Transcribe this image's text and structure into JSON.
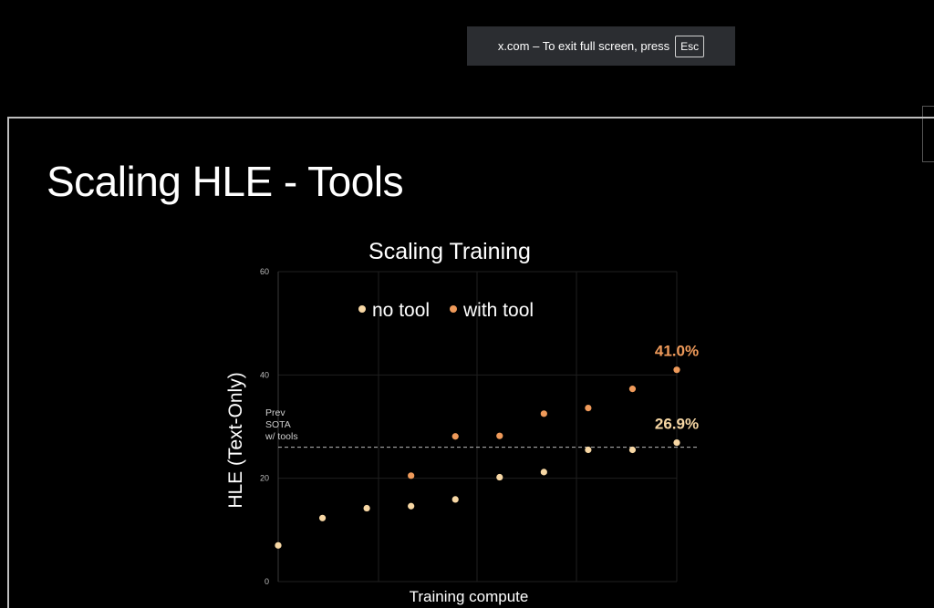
{
  "banner": {
    "message": "x.com – To exit full screen, press",
    "key": "Esc"
  },
  "slide": {
    "title": "Scaling HLE - Tools"
  },
  "chart_data": {
    "type": "scatter",
    "title": "Scaling Training",
    "xlabel": "Training compute",
    "ylabel": "HLE (Text-Only)",
    "ylim": [
      0,
      60
    ],
    "yticks": [
      "0",
      "20",
      "40",
      "60"
    ],
    "grid": true,
    "legend": {
      "placement": "top-left",
      "entries": [
        "no tool",
        "with tool"
      ]
    },
    "series": [
      {
        "name": "no tool",
        "color": "#f7d7a4",
        "x": [
          1,
          2,
          3,
          4,
          5,
          6,
          7,
          8,
          9,
          10
        ],
        "y": [
          7.0,
          12.3,
          14.2,
          14.6,
          15.9,
          20.2,
          21.2,
          25.5,
          25.5,
          26.9
        ]
      },
      {
        "name": "with tool",
        "color": "#ef9a5a",
        "x": [
          4,
          5,
          6,
          7,
          8,
          9,
          10
        ],
        "y": [
          20.5,
          28.1,
          28.2,
          32.5,
          33.6,
          37.3,
          41.0
        ]
      }
    ],
    "reference_line": {
      "y": 26.0,
      "label_lines": [
        "Prev",
        "SOTA",
        "w/ tools"
      ]
    },
    "annotations": [
      {
        "text": "41.0%",
        "x": 10,
        "y": 41.0,
        "color": "#ef9a5a"
      },
      {
        "text": "26.9%",
        "x": 10,
        "y": 26.9,
        "color": "#f7d7a4"
      }
    ]
  }
}
